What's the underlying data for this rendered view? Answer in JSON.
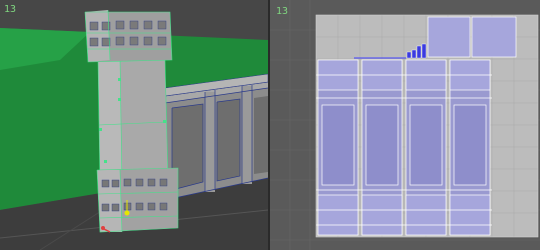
{
  "viewports": {
    "perspective": {
      "label": "13"
    },
    "uv_editor": {
      "label": "13"
    }
  }
}
